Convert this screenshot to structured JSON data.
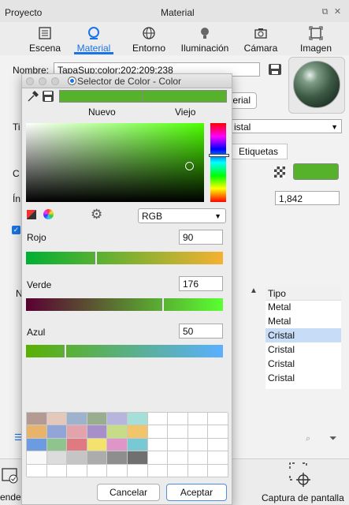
{
  "panel": {
    "title": "Proyecto",
    "center_title": "Material",
    "tabs": [
      {
        "label": "Escena",
        "icon": "list-icon"
      },
      {
        "label": "Material",
        "icon": "material-icon"
      },
      {
        "label": "Entorno",
        "icon": "globe-icon"
      },
      {
        "label": "Iluminación",
        "icon": "bulb-icon"
      },
      {
        "label": "Cámara",
        "icon": "camera-icon"
      },
      {
        "label": "Imagen",
        "icon": "image-icon"
      }
    ],
    "name_label": "Nombre:",
    "name_value": "TapaSup:color:202:209:238",
    "edit_material_fragment": "terial",
    "type_fragment": "Ti",
    "type_value_fragment": "istal",
    "tab_labels_fragment": "Etiquetas",
    "color_fragment": "C",
    "index_fragment": "Ín",
    "index_value": "1,842",
    "table_header_fragment": "N",
    "table_type_header": "Tipo",
    "table_rows": [
      "Metal",
      "Metal",
      "Cristal",
      "Cristal",
      "Cristal",
      "Cristal"
    ],
    "selected_row": 2,
    "bottom_left_fragment": "ende",
    "screenshot_label": "Captura de pantalla",
    "accent_color": "#1a73e8"
  },
  "dialog": {
    "title": "Selector de Color - Color",
    "new_label": "Nuevo",
    "old_label": "Viejo",
    "current_color": "#57b22b",
    "mode": "RGB",
    "red_label": "Rojo",
    "red_value": "90",
    "green_label": "Verde",
    "green_value": "176",
    "blue_label": "Azul",
    "blue_value": "50",
    "cancel_label": "Cancelar",
    "accept_label": "Aceptar",
    "swatch_colors": [
      [
        "#b39a93",
        "#e4c8bc",
        "#9fb2cd",
        "#98ae8f",
        "#b7b5dc",
        "#a6dfd7",
        "",
        "",
        "",
        ""
      ],
      [
        "#e8b36a",
        "#93a4d6",
        "#e3a3ad",
        "#a78fc9",
        "#c7dc86",
        "#f1c56a",
        "",
        "",
        "",
        ""
      ],
      [
        "#6d9be0",
        "#8fc48f",
        "#e07a82",
        "#f3e36e",
        "#de96c9",
        "#78c9d3",
        "",
        "",
        "",
        ""
      ],
      [
        "#f8f8f8",
        "#dcdcdc",
        "#c5c5c5",
        "#acacac",
        "#8e8e8e",
        "#707070",
        "",
        "",
        "",
        ""
      ],
      [
        "",
        "",
        "",
        "",
        "",
        "",
        "",
        "",
        "",
        ""
      ]
    ]
  }
}
